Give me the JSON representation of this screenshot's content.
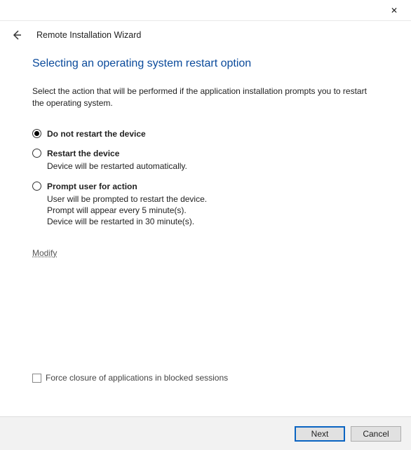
{
  "titlebar": {
    "close_label": "✕"
  },
  "header": {
    "back_arrow": "←",
    "wizard_title": "Remote Installation Wizard"
  },
  "heading": "Selecting an operating system restart option",
  "description": "Select the action that will be performed if the application installation prompts you to restart the operating system.",
  "options": [
    {
      "label": "Do not restart the device",
      "selected": true,
      "sub": null
    },
    {
      "label": "Restart the device",
      "selected": false,
      "sub": "Device will be restarted automatically."
    },
    {
      "label": "Prompt user for action",
      "selected": false,
      "sub": "User will be prompted to restart the device.\nPrompt will appear every 5 minute(s).\nDevice will be restarted in 30 minute(s)."
    }
  ],
  "modify_link": "Modify",
  "force_closure": {
    "checked": false,
    "label": "Force closure of applications in blocked sessions"
  },
  "footer": {
    "next": "Next",
    "cancel": "Cancel"
  }
}
